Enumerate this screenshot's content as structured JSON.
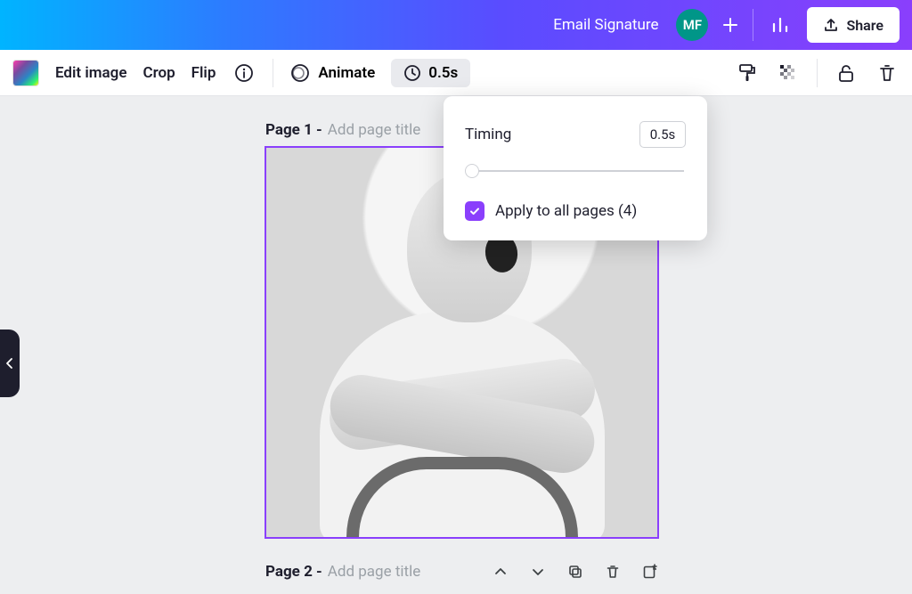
{
  "header": {
    "doc_title": "Email Signature",
    "avatar_initials": "MF",
    "share_label": "Share"
  },
  "toolbar": {
    "edit_image": "Edit image",
    "crop": "Crop",
    "flip": "Flip",
    "animate": "Animate",
    "timing_value": "0.5s"
  },
  "popover": {
    "timing_label": "Timing",
    "timing_value": "0.5s",
    "apply_all_label": "Apply to all pages (4)",
    "apply_all_checked": true
  },
  "pages": {
    "page1_prefix": "Page 1 - ",
    "page2_prefix": "Page 2 - ",
    "title_placeholder": "Add page title"
  }
}
